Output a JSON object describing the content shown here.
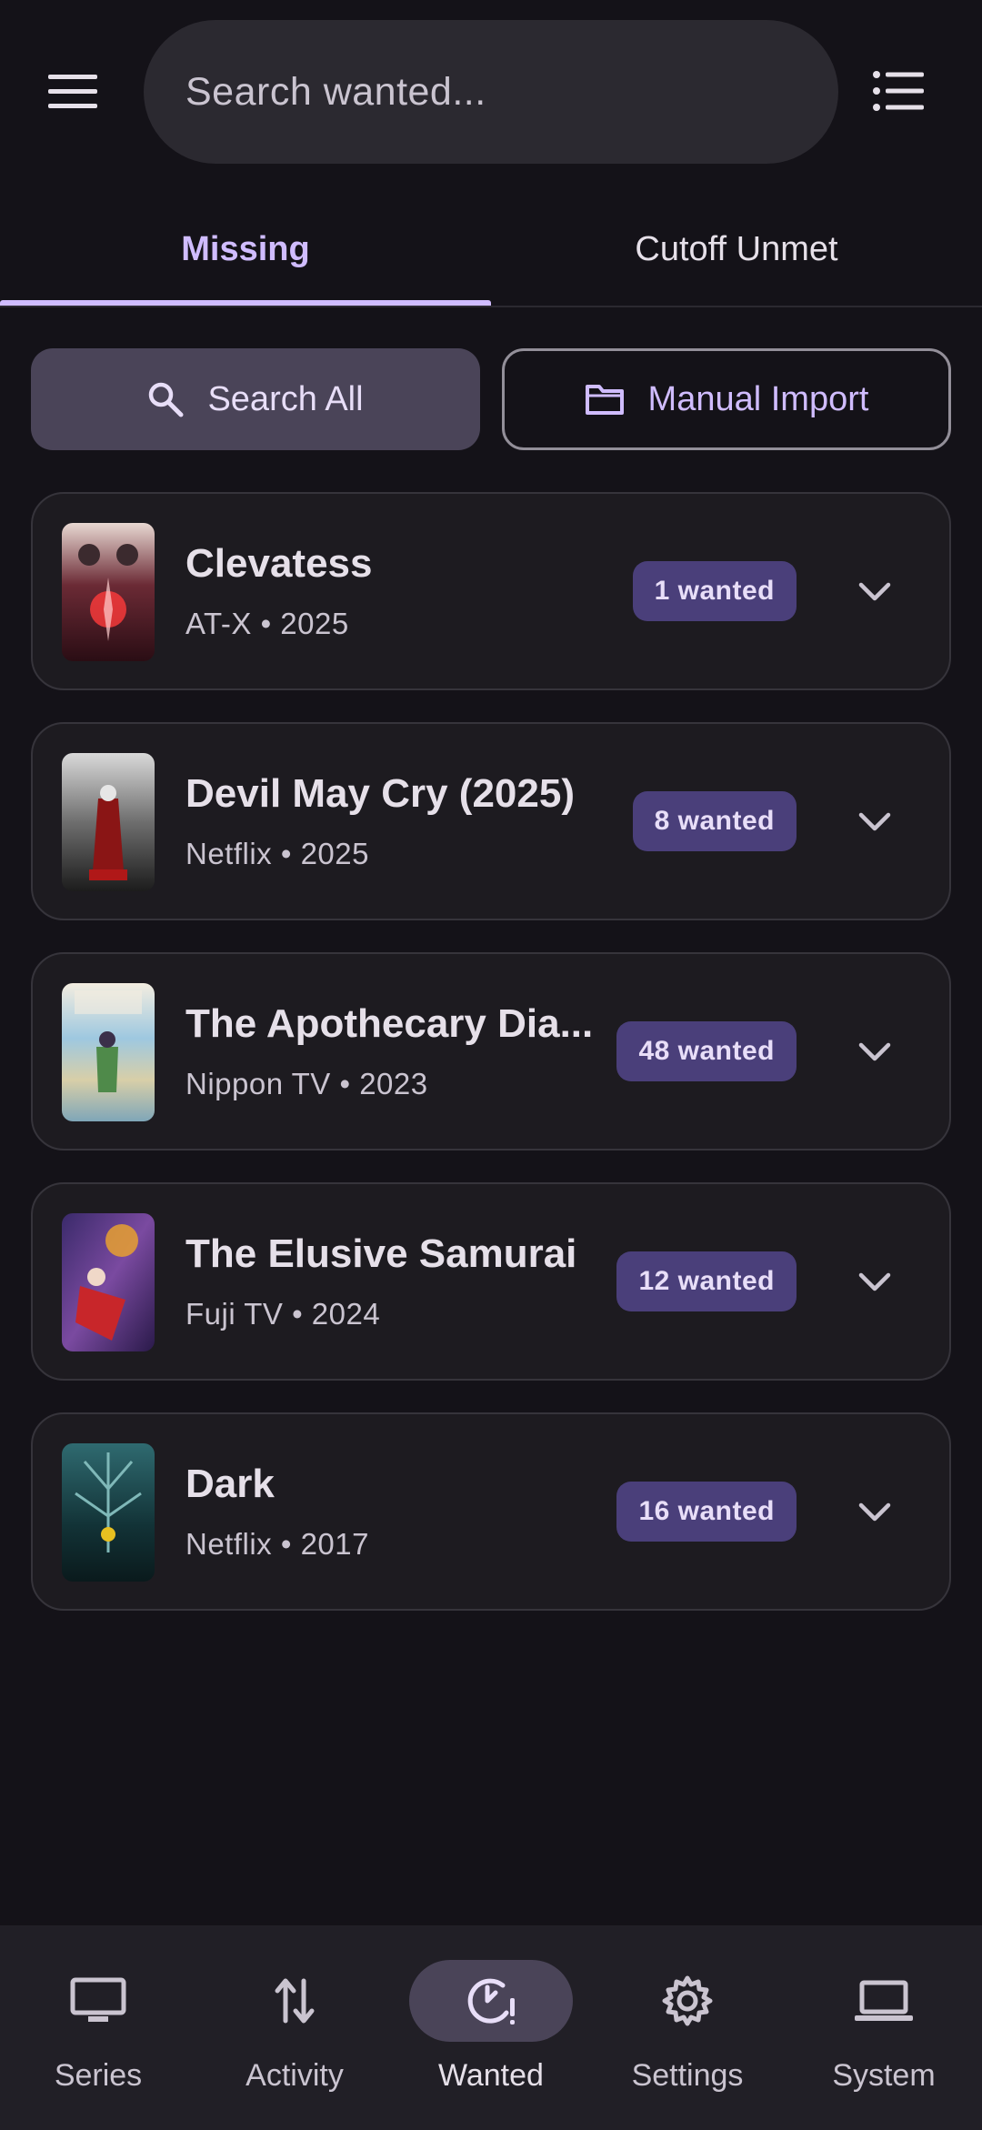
{
  "search": {
    "placeholder": "Search wanted..."
  },
  "tabs": [
    {
      "label": "Missing",
      "active": true
    },
    {
      "label": "Cutoff Unmet",
      "active": false
    }
  ],
  "actions": {
    "search_all": "Search All",
    "manual_import": "Manual Import"
  },
  "series": [
    {
      "title": "Clevatess",
      "network": "AT-X",
      "year": "2025",
      "subtitle": "AT-X • 2025",
      "wanted": "1 wanted"
    },
    {
      "title": "Devil May Cry (2025)",
      "network": "Netflix",
      "year": "2025",
      "subtitle": "Netflix • 2025",
      "wanted": "8 wanted"
    },
    {
      "title": "The Apothecary Dia...",
      "network": "Nippon TV",
      "year": "2023",
      "subtitle": "Nippon TV • 2023",
      "wanted": "48 wanted"
    },
    {
      "title": "The Elusive Samurai",
      "network": "Fuji TV",
      "year": "2024",
      "subtitle": "Fuji TV • 2024",
      "wanted": "12 wanted"
    },
    {
      "title": "Dark",
      "network": "Netflix",
      "year": "2017",
      "subtitle": "Netflix • 2017",
      "wanted": "16 wanted"
    }
  ],
  "nav": [
    {
      "label": "Series",
      "icon": "monitor-icon",
      "active": false
    },
    {
      "label": "Activity",
      "icon": "up-down-arrows-icon",
      "active": false
    },
    {
      "label": "Wanted",
      "icon": "clock-alert-icon",
      "active": true
    },
    {
      "label": "Settings",
      "icon": "gear-icon",
      "active": false
    },
    {
      "label": "System",
      "icon": "laptop-icon",
      "active": false
    }
  ],
  "colors": {
    "background": "#141218",
    "accent": "#d0bcff",
    "surface": "#1d1b20",
    "badge": "#4a3f7a",
    "tonal_button": "#4a4458"
  }
}
